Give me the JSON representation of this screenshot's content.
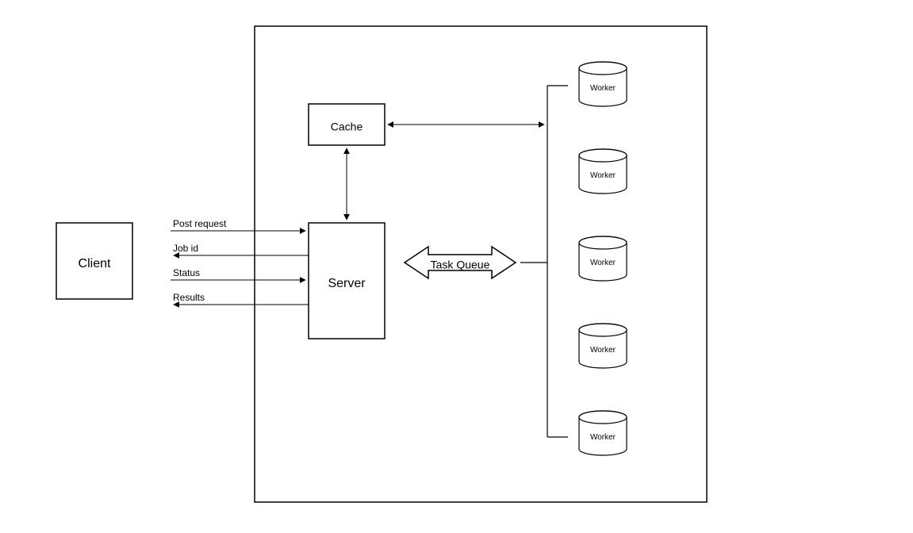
{
  "nodes": {
    "client": "Client",
    "server": "Server",
    "cache": "Cache",
    "task_queue": "Task Queue"
  },
  "workers": [
    "Worker",
    "Worker",
    "Worker",
    "Worker",
    "Worker"
  ],
  "edges": {
    "post_request": "Post request",
    "job_id": "Job id",
    "status": "Status",
    "results": "Results"
  }
}
